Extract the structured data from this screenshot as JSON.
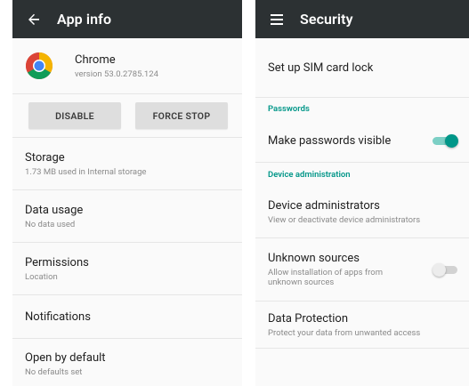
{
  "left": {
    "title": "App info",
    "app": {
      "name": "Chrome",
      "version": "version 53.0.2785.124"
    },
    "buttons": {
      "disable": "DISABLE",
      "force_stop": "FORCE STOP"
    },
    "items": [
      {
        "title": "Storage",
        "subtitle": "1.73 MB used in Internal storage"
      },
      {
        "title": "Data usage",
        "subtitle": "No data used"
      },
      {
        "title": "Permissions",
        "subtitle": "Location"
      },
      {
        "title": "Notifications",
        "subtitle": ""
      },
      {
        "title": "Open by default",
        "subtitle": "No defaults set"
      }
    ]
  },
  "right": {
    "title": "Security",
    "sim_lock": "Set up SIM card lock",
    "section_passwords": "Passwords",
    "make_visible": "Make passwords visible",
    "make_visible_on": true,
    "section_device_admin": "Device administration",
    "device_admins": {
      "title": "Device administrators",
      "subtitle": "View or deactivate device administrators"
    },
    "unknown_sources": {
      "title": "Unknown sources",
      "subtitle": "Allow installation of apps from unknown sources",
      "enabled": false
    },
    "data_protection": {
      "title": "Data Protection",
      "subtitle": "Protect your data from unwanted access"
    }
  },
  "colors": {
    "toolbar": "#2c3133",
    "accent": "#009688"
  },
  "icons": {
    "back": "arrow-left-icon",
    "menu": "hamburger-menu-icon",
    "app": "chrome-logo-icon"
  }
}
